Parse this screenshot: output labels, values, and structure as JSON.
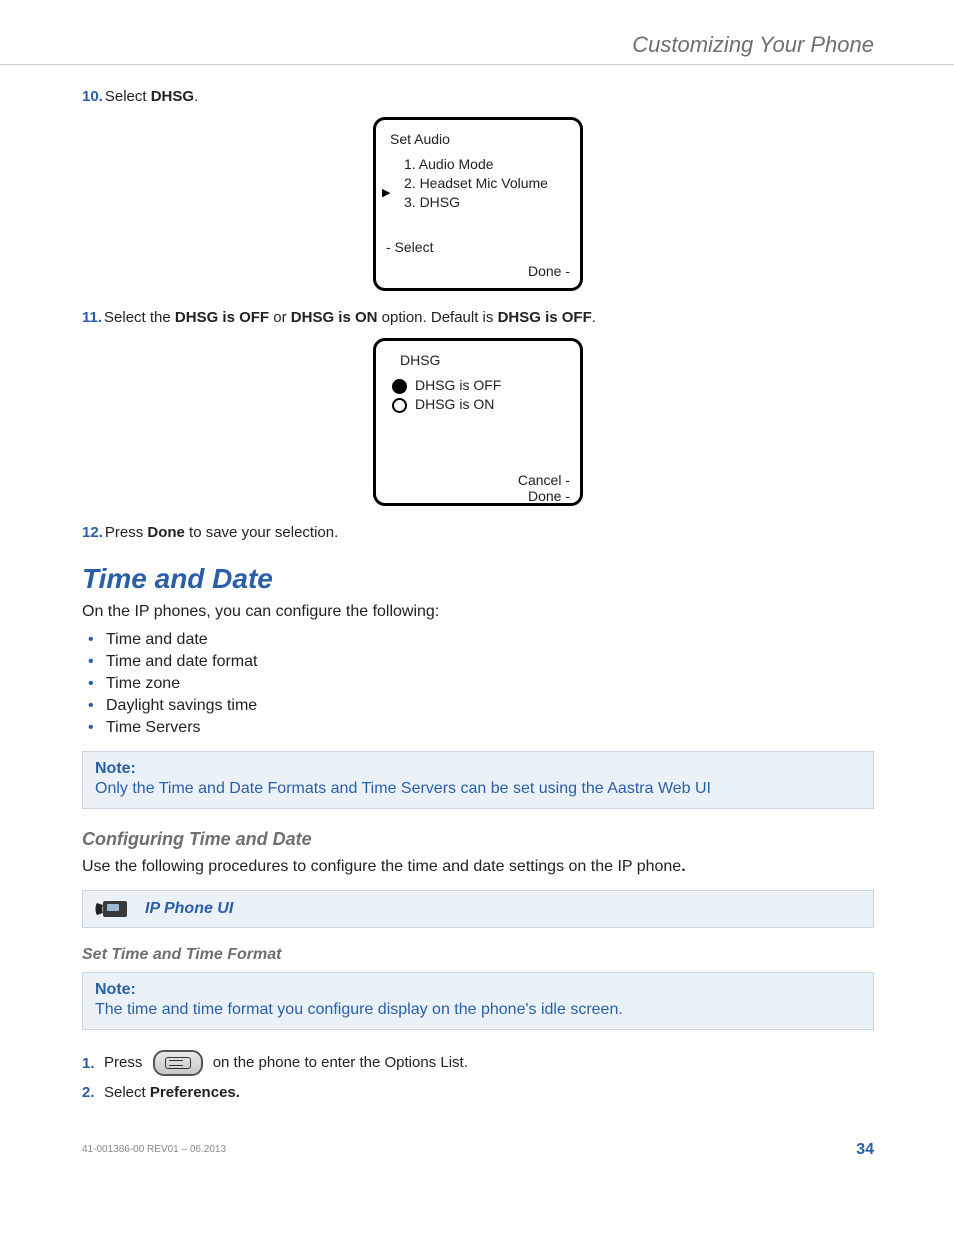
{
  "header": {
    "section_title": "Customizing Your Phone"
  },
  "steps": {
    "s10": {
      "num": "10.",
      "prefix": "Select ",
      "bold": "DHSG",
      "suffix": "."
    },
    "s11": {
      "num": "11.",
      "prefix": "Select the ",
      "b1": "DHSG is OFF",
      "mid1": " or ",
      "b2": "DHSG is ON",
      "mid2": " option. Default is ",
      "b3": "DHSG is OFF",
      "suffix": "."
    },
    "s12": {
      "num": "12.",
      "prefix": "Press ",
      "bold": "Done",
      "suffix": " to save your selection."
    }
  },
  "screen1": {
    "title": "Set Audio",
    "item1": "1. Audio Mode",
    "item2": "2. Headset Mic Volume",
    "item3": "3. DHSG",
    "soft_left": "- Select",
    "soft_right": "Done -"
  },
  "screen2": {
    "title": "DHSG",
    "opt1": "DHSG is OFF",
    "opt2": "DHSG is ON",
    "soft_cancel": "Cancel -",
    "soft_done": "Done -"
  },
  "section": {
    "heading": "Time and Date",
    "intro": "On the IP phones, you can configure the following:",
    "bullets": {
      "b1": "Time and date",
      "b2": "Time and date format",
      "b3": "Time zone",
      "b4": "Daylight savings time",
      "b5": "Time Servers"
    }
  },
  "note1": {
    "label": "Note:",
    "body": "Only the Time and Date Formats and Time Servers can be set using the Aastra Web UI"
  },
  "subhead1": "Configuring Time and Date",
  "para1": {
    "text": "Use the following procedures to configure the time and date settings on the IP phone",
    "bold_period": "."
  },
  "uibox": {
    "label": "IP Phone UI"
  },
  "subhead2": "Set Time and Time Format",
  "note2": {
    "label": "Note:",
    "body": "The time and time format you configure display on the phone's idle screen."
  },
  "steps2": {
    "s1": {
      "num": "1.",
      "pre": "Press ",
      "post": " on the phone to enter the Options List."
    },
    "s2": {
      "num": "2.",
      "pre": "Select ",
      "bold": "Preferences."
    }
  },
  "footer": {
    "left": "41-001386-00 REV01 – 06.2013",
    "page": "34"
  }
}
